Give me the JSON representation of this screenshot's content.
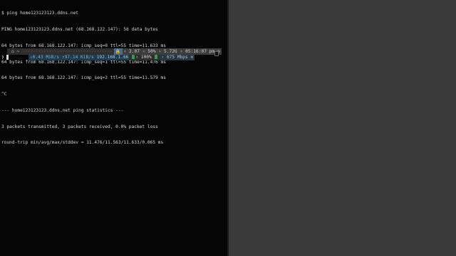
{
  "terminal": {
    "lines": [
      "$ ping home123123123.ddns.net",
      "PING home123123123.ddns.net (68.168.122.147): 56 data bytes",
      "64 bytes from 68.168.122.147: icmp_seq=0 ttl=55 time=11.633 ms",
      "64 bytes from 68.168.122.147: icmp_seq=1 ttl=55 time=11.476 ms",
      "64 bytes from 68.168.122.147: icmp_seq=2 ttl=55 time=11.579 ms",
      "^C",
      "--- home123123123.ddns.net ping statistics ---",
      "3 packets transmitted, 3 packets received, 0.0% packet loss",
      "round-trip min/avg/max/stddev = 11.476/11.563/11.633/0.065 ms"
    ]
  },
  "statusbar_top": {
    "left": " ~",
    "dots": "··································",
    "load": "2.07",
    "cpu": "50%",
    "mem": "5.72G",
    "time": "05:16:07 pm"
  },
  "statusbar_bottom": {
    "down": "↓0.43 MiB/s",
    "up": "↑97.14 KiB/s",
    "ip": "192.168.1.66",
    "battery": "100%",
    "speed": "675 Mbps"
  },
  "prompt": {
    "symbol": "❯"
  },
  "colors": {
    "terminal_bg": "#050505",
    "right_pane_bg": "#3a3a3a",
    "battery_green": "#2ea043"
  }
}
